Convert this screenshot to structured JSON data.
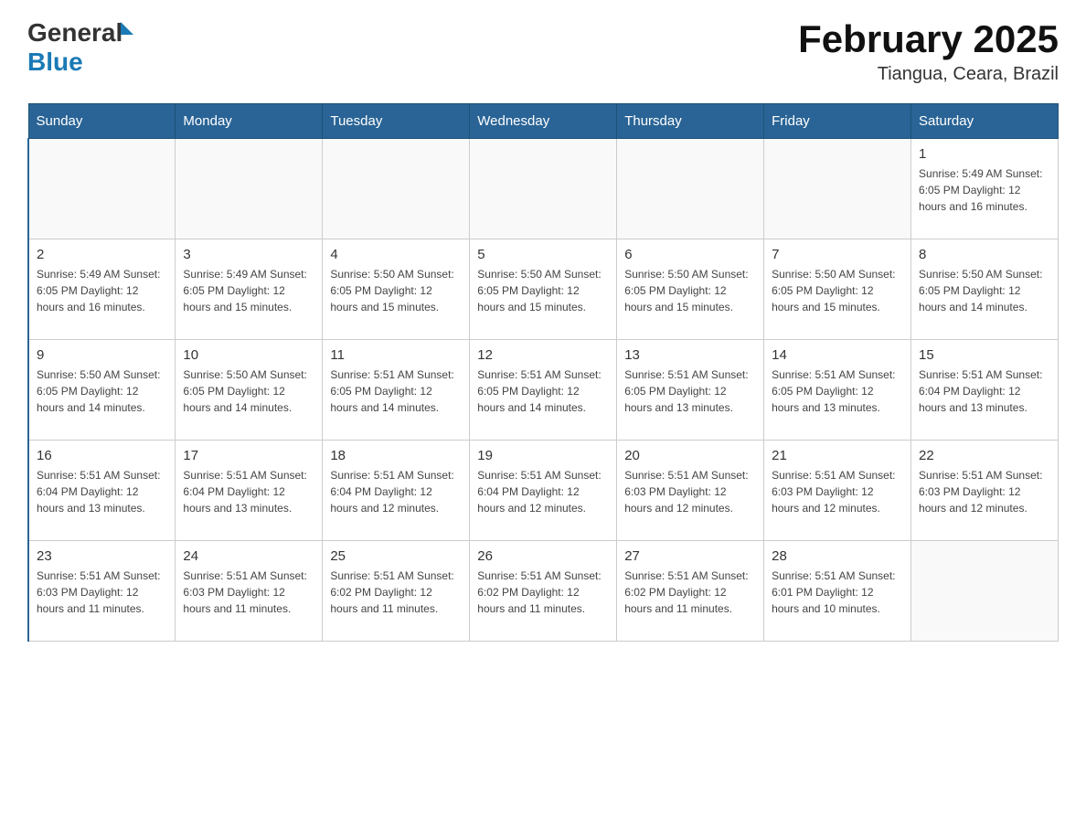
{
  "header": {
    "logo_general": "General",
    "logo_blue": "Blue",
    "title": "February 2025",
    "subtitle": "Tiangua, Ceara, Brazil"
  },
  "days_of_week": [
    "Sunday",
    "Monday",
    "Tuesday",
    "Wednesday",
    "Thursday",
    "Friday",
    "Saturday"
  ],
  "weeks": [
    [
      {
        "day": "",
        "info": ""
      },
      {
        "day": "",
        "info": ""
      },
      {
        "day": "",
        "info": ""
      },
      {
        "day": "",
        "info": ""
      },
      {
        "day": "",
        "info": ""
      },
      {
        "day": "",
        "info": ""
      },
      {
        "day": "1",
        "info": "Sunrise: 5:49 AM\nSunset: 6:05 PM\nDaylight: 12 hours\nand 16 minutes."
      }
    ],
    [
      {
        "day": "2",
        "info": "Sunrise: 5:49 AM\nSunset: 6:05 PM\nDaylight: 12 hours\nand 16 minutes."
      },
      {
        "day": "3",
        "info": "Sunrise: 5:49 AM\nSunset: 6:05 PM\nDaylight: 12 hours\nand 15 minutes."
      },
      {
        "day": "4",
        "info": "Sunrise: 5:50 AM\nSunset: 6:05 PM\nDaylight: 12 hours\nand 15 minutes."
      },
      {
        "day": "5",
        "info": "Sunrise: 5:50 AM\nSunset: 6:05 PM\nDaylight: 12 hours\nand 15 minutes."
      },
      {
        "day": "6",
        "info": "Sunrise: 5:50 AM\nSunset: 6:05 PM\nDaylight: 12 hours\nand 15 minutes."
      },
      {
        "day": "7",
        "info": "Sunrise: 5:50 AM\nSunset: 6:05 PM\nDaylight: 12 hours\nand 15 minutes."
      },
      {
        "day": "8",
        "info": "Sunrise: 5:50 AM\nSunset: 6:05 PM\nDaylight: 12 hours\nand 14 minutes."
      }
    ],
    [
      {
        "day": "9",
        "info": "Sunrise: 5:50 AM\nSunset: 6:05 PM\nDaylight: 12 hours\nand 14 minutes."
      },
      {
        "day": "10",
        "info": "Sunrise: 5:50 AM\nSunset: 6:05 PM\nDaylight: 12 hours\nand 14 minutes."
      },
      {
        "day": "11",
        "info": "Sunrise: 5:51 AM\nSunset: 6:05 PM\nDaylight: 12 hours\nand 14 minutes."
      },
      {
        "day": "12",
        "info": "Sunrise: 5:51 AM\nSunset: 6:05 PM\nDaylight: 12 hours\nand 14 minutes."
      },
      {
        "day": "13",
        "info": "Sunrise: 5:51 AM\nSunset: 6:05 PM\nDaylight: 12 hours\nand 13 minutes."
      },
      {
        "day": "14",
        "info": "Sunrise: 5:51 AM\nSunset: 6:05 PM\nDaylight: 12 hours\nand 13 minutes."
      },
      {
        "day": "15",
        "info": "Sunrise: 5:51 AM\nSunset: 6:04 PM\nDaylight: 12 hours\nand 13 minutes."
      }
    ],
    [
      {
        "day": "16",
        "info": "Sunrise: 5:51 AM\nSunset: 6:04 PM\nDaylight: 12 hours\nand 13 minutes."
      },
      {
        "day": "17",
        "info": "Sunrise: 5:51 AM\nSunset: 6:04 PM\nDaylight: 12 hours\nand 13 minutes."
      },
      {
        "day": "18",
        "info": "Sunrise: 5:51 AM\nSunset: 6:04 PM\nDaylight: 12 hours\nand 12 minutes."
      },
      {
        "day": "19",
        "info": "Sunrise: 5:51 AM\nSunset: 6:04 PM\nDaylight: 12 hours\nand 12 minutes."
      },
      {
        "day": "20",
        "info": "Sunrise: 5:51 AM\nSunset: 6:03 PM\nDaylight: 12 hours\nand 12 minutes."
      },
      {
        "day": "21",
        "info": "Sunrise: 5:51 AM\nSunset: 6:03 PM\nDaylight: 12 hours\nand 12 minutes."
      },
      {
        "day": "22",
        "info": "Sunrise: 5:51 AM\nSunset: 6:03 PM\nDaylight: 12 hours\nand 12 minutes."
      }
    ],
    [
      {
        "day": "23",
        "info": "Sunrise: 5:51 AM\nSunset: 6:03 PM\nDaylight: 12 hours\nand 11 minutes."
      },
      {
        "day": "24",
        "info": "Sunrise: 5:51 AM\nSunset: 6:03 PM\nDaylight: 12 hours\nand 11 minutes."
      },
      {
        "day": "25",
        "info": "Sunrise: 5:51 AM\nSunset: 6:02 PM\nDaylight: 12 hours\nand 11 minutes."
      },
      {
        "day": "26",
        "info": "Sunrise: 5:51 AM\nSunset: 6:02 PM\nDaylight: 12 hours\nand 11 minutes."
      },
      {
        "day": "27",
        "info": "Sunrise: 5:51 AM\nSunset: 6:02 PM\nDaylight: 12 hours\nand 11 minutes."
      },
      {
        "day": "28",
        "info": "Sunrise: 5:51 AM\nSunset: 6:01 PM\nDaylight: 12 hours\nand 10 minutes."
      },
      {
        "day": "",
        "info": ""
      }
    ]
  ]
}
